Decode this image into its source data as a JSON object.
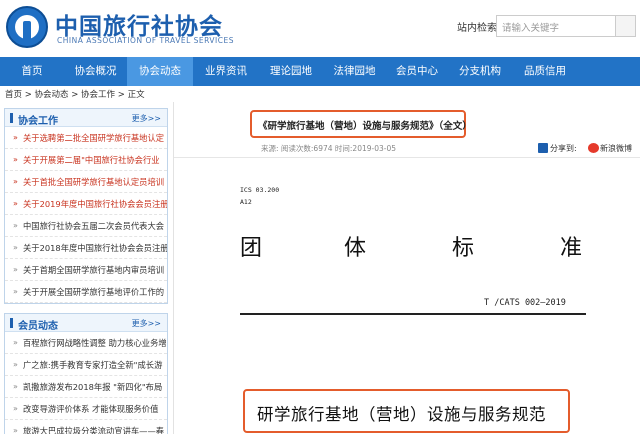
{
  "header": {
    "site_title": "中国旅行社协会",
    "site_subtitle": "CHINA ASSOCIATION OF TRAVEL SERVICES",
    "search_label": "站内检索",
    "search_placeholder": "请输入关键字"
  },
  "nav": {
    "items": [
      "首页",
      "协会概况",
      "协会动态",
      "业界资讯",
      "理论园地",
      "法律园地",
      "会员中心",
      "分支机构",
      "品质信用"
    ],
    "active": "协会动态"
  },
  "breadcrumb": "首页 > 协会动态 > 协会工作 > 正文",
  "sidebar": {
    "work": {
      "title": "协会工作",
      "more": "更多>>",
      "items": [
        "关于选聘第二批全国研学旅行基地认定",
        "关于开展第二届\"中国旅行社协会行业",
        "关于首批全国研学旅行基地认定员培训",
        "关于2019年度中国旅行社协会会员注册",
        "中国旅行社协会五届二次会员代表大会",
        "关于2018年度中国旅行社协会会员注册",
        "关于首期全国研学旅行基地内审员培训",
        "关于开展全国研学旅行基地评价工作的"
      ]
    },
    "members": {
      "title": "会员动态",
      "more": "更多>>",
      "items": [
        "百程旅行网战略性调整 助力核心业务增",
        "广之旅:携手教育专家打造全新\"成长游",
        "凯撒旅游发布2018年报 \"新四化\"布局",
        "改变导游评价体系 才能体现服务价值",
        "旅游大巴成拉圾分类流动宣讲车——春"
      ]
    }
  },
  "article": {
    "title": "《研学旅行基地（营地）设施与服务规范》（全文）",
    "meta": "来源:    阅读次数:6974   时间:2019-03-05",
    "share_label": "分享到:",
    "weibo_label": "新浪微博",
    "doc": {
      "ics": "ICS 03.200",
      "class_code": "A12",
      "standard_chars": [
        "团",
        "体",
        "标",
        "准"
      ],
      "standard_no": "T /CATS 002—2019",
      "doc_title": "研学旅行基地（营地）设施与服务规范"
    }
  }
}
